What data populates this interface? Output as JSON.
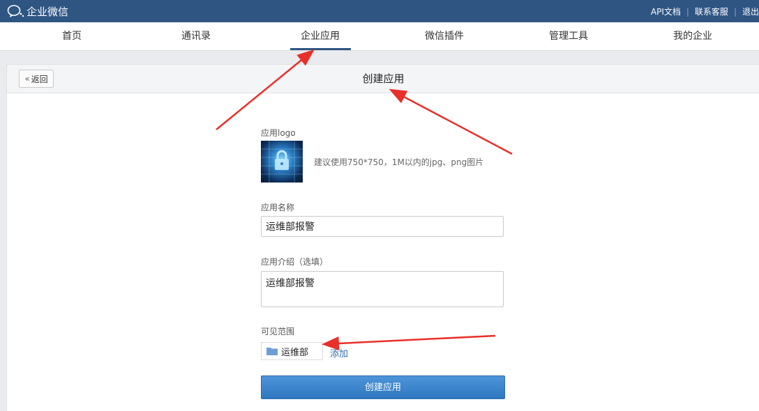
{
  "topbar": {
    "brand": "企业微信",
    "links": [
      "API文档",
      "联系客服",
      "退出"
    ]
  },
  "nav": {
    "items": [
      "首页",
      "通讯录",
      "企业应用",
      "微信插件",
      "管理工具",
      "我的企业"
    ],
    "active_index": 2
  },
  "panel": {
    "back_label": "返回",
    "title": "创建应用"
  },
  "form": {
    "logo_label": "应用logo",
    "logo_hint": "建议使用750*750，1M以内的jpg、png图片",
    "logo_icon": "lock-icon",
    "name_label": "应用名称",
    "name_value": "运维部报警",
    "intro_label": "应用介绍（选填）",
    "intro_value": "运维部报警",
    "scope_label": "可见范围",
    "scope_item": "运维部",
    "scope_icon": "folder-icon",
    "add_label": "添加",
    "submit_label": "创建应用"
  },
  "colors": {
    "topbar": "#2f5583",
    "accent": "#2f78c0",
    "annotation": "#e8302a"
  }
}
